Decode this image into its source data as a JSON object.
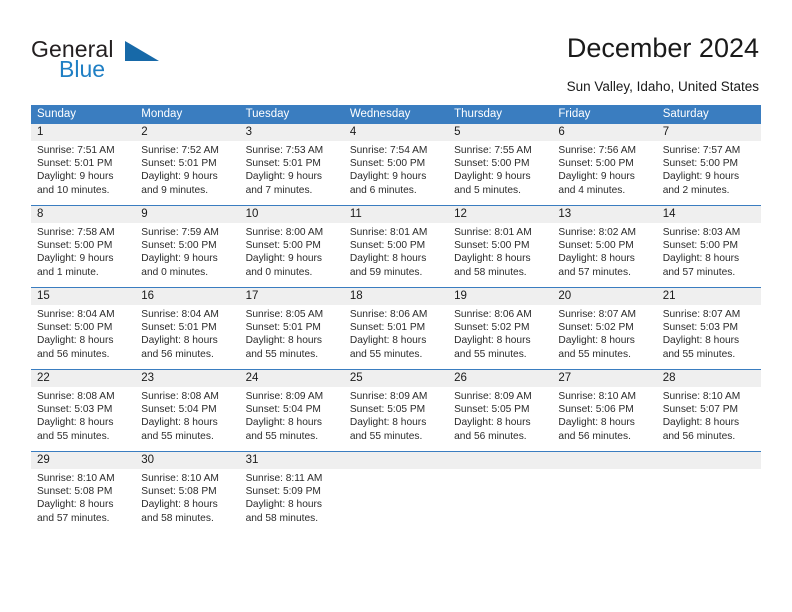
{
  "brand": {
    "name_top": "General",
    "name_bottom": "Blue",
    "accent_color": "#1769a8",
    "text_color": "#231f20"
  },
  "header": {
    "title": "December 2024",
    "subtitle": "Sun Valley, Idaho, United States"
  },
  "theme": {
    "header_row_bg": "#3a7dc0",
    "header_row_text": "#ffffff",
    "daynum_bg": "#efefef",
    "cell_bg": "#ffffff",
    "week_divider": "#3a7dc0"
  },
  "day_headers": [
    "Sunday",
    "Monday",
    "Tuesday",
    "Wednesday",
    "Thursday",
    "Friday",
    "Saturday"
  ],
  "weeks": [
    {
      "days": [
        {
          "num": "1",
          "sunrise": "Sunrise: 7:51 AM",
          "sunset": "Sunset: 5:01 PM",
          "daylight1": "Daylight: 9 hours",
          "daylight2": "and 10 minutes."
        },
        {
          "num": "2",
          "sunrise": "Sunrise: 7:52 AM",
          "sunset": "Sunset: 5:01 PM",
          "daylight1": "Daylight: 9 hours",
          "daylight2": "and 9 minutes."
        },
        {
          "num": "3",
          "sunrise": "Sunrise: 7:53 AM",
          "sunset": "Sunset: 5:01 PM",
          "daylight1": "Daylight: 9 hours",
          "daylight2": "and 7 minutes."
        },
        {
          "num": "4",
          "sunrise": "Sunrise: 7:54 AM",
          "sunset": "Sunset: 5:00 PM",
          "daylight1": "Daylight: 9 hours",
          "daylight2": "and 6 minutes."
        },
        {
          "num": "5",
          "sunrise": "Sunrise: 7:55 AM",
          "sunset": "Sunset: 5:00 PM",
          "daylight1": "Daylight: 9 hours",
          "daylight2": "and 5 minutes."
        },
        {
          "num": "6",
          "sunrise": "Sunrise: 7:56 AM",
          "sunset": "Sunset: 5:00 PM",
          "daylight1": "Daylight: 9 hours",
          "daylight2": "and 4 minutes."
        },
        {
          "num": "7",
          "sunrise": "Sunrise: 7:57 AM",
          "sunset": "Sunset: 5:00 PM",
          "daylight1": "Daylight: 9 hours",
          "daylight2": "and 2 minutes."
        }
      ]
    },
    {
      "days": [
        {
          "num": "8",
          "sunrise": "Sunrise: 7:58 AM",
          "sunset": "Sunset: 5:00 PM",
          "daylight1": "Daylight: 9 hours",
          "daylight2": "and 1 minute."
        },
        {
          "num": "9",
          "sunrise": "Sunrise: 7:59 AM",
          "sunset": "Sunset: 5:00 PM",
          "daylight1": "Daylight: 9 hours",
          "daylight2": "and 0 minutes."
        },
        {
          "num": "10",
          "sunrise": "Sunrise: 8:00 AM",
          "sunset": "Sunset: 5:00 PM",
          "daylight1": "Daylight: 9 hours",
          "daylight2": "and 0 minutes."
        },
        {
          "num": "11",
          "sunrise": "Sunrise: 8:01 AM",
          "sunset": "Sunset: 5:00 PM",
          "daylight1": "Daylight: 8 hours",
          "daylight2": "and 59 minutes."
        },
        {
          "num": "12",
          "sunrise": "Sunrise: 8:01 AM",
          "sunset": "Sunset: 5:00 PM",
          "daylight1": "Daylight: 8 hours",
          "daylight2": "and 58 minutes."
        },
        {
          "num": "13",
          "sunrise": "Sunrise: 8:02 AM",
          "sunset": "Sunset: 5:00 PM",
          "daylight1": "Daylight: 8 hours",
          "daylight2": "and 57 minutes."
        },
        {
          "num": "14",
          "sunrise": "Sunrise: 8:03 AM",
          "sunset": "Sunset: 5:00 PM",
          "daylight1": "Daylight: 8 hours",
          "daylight2": "and 57 minutes."
        }
      ]
    },
    {
      "days": [
        {
          "num": "15",
          "sunrise": "Sunrise: 8:04 AM",
          "sunset": "Sunset: 5:00 PM",
          "daylight1": "Daylight: 8 hours",
          "daylight2": "and 56 minutes."
        },
        {
          "num": "16",
          "sunrise": "Sunrise: 8:04 AM",
          "sunset": "Sunset: 5:01 PM",
          "daylight1": "Daylight: 8 hours",
          "daylight2": "and 56 minutes."
        },
        {
          "num": "17",
          "sunrise": "Sunrise: 8:05 AM",
          "sunset": "Sunset: 5:01 PM",
          "daylight1": "Daylight: 8 hours",
          "daylight2": "and 55 minutes."
        },
        {
          "num": "18",
          "sunrise": "Sunrise: 8:06 AM",
          "sunset": "Sunset: 5:01 PM",
          "daylight1": "Daylight: 8 hours",
          "daylight2": "and 55 minutes."
        },
        {
          "num": "19",
          "sunrise": "Sunrise: 8:06 AM",
          "sunset": "Sunset: 5:02 PM",
          "daylight1": "Daylight: 8 hours",
          "daylight2": "and 55 minutes."
        },
        {
          "num": "20",
          "sunrise": "Sunrise: 8:07 AM",
          "sunset": "Sunset: 5:02 PM",
          "daylight1": "Daylight: 8 hours",
          "daylight2": "and 55 minutes."
        },
        {
          "num": "21",
          "sunrise": "Sunrise: 8:07 AM",
          "sunset": "Sunset: 5:03 PM",
          "daylight1": "Daylight: 8 hours",
          "daylight2": "and 55 minutes."
        }
      ]
    },
    {
      "days": [
        {
          "num": "22",
          "sunrise": "Sunrise: 8:08 AM",
          "sunset": "Sunset: 5:03 PM",
          "daylight1": "Daylight: 8 hours",
          "daylight2": "and 55 minutes."
        },
        {
          "num": "23",
          "sunrise": "Sunrise: 8:08 AM",
          "sunset": "Sunset: 5:04 PM",
          "daylight1": "Daylight: 8 hours",
          "daylight2": "and 55 minutes."
        },
        {
          "num": "24",
          "sunrise": "Sunrise: 8:09 AM",
          "sunset": "Sunset: 5:04 PM",
          "daylight1": "Daylight: 8 hours",
          "daylight2": "and 55 minutes."
        },
        {
          "num": "25",
          "sunrise": "Sunrise: 8:09 AM",
          "sunset": "Sunset: 5:05 PM",
          "daylight1": "Daylight: 8 hours",
          "daylight2": "and 55 minutes."
        },
        {
          "num": "26",
          "sunrise": "Sunrise: 8:09 AM",
          "sunset": "Sunset: 5:05 PM",
          "daylight1": "Daylight: 8 hours",
          "daylight2": "and 56 minutes."
        },
        {
          "num": "27",
          "sunrise": "Sunrise: 8:10 AM",
          "sunset": "Sunset: 5:06 PM",
          "daylight1": "Daylight: 8 hours",
          "daylight2": "and 56 minutes."
        },
        {
          "num": "28",
          "sunrise": "Sunrise: 8:10 AM",
          "sunset": "Sunset: 5:07 PM",
          "daylight1": "Daylight: 8 hours",
          "daylight2": "and 56 minutes."
        }
      ]
    },
    {
      "days": [
        {
          "num": "29",
          "sunrise": "Sunrise: 8:10 AM",
          "sunset": "Sunset: 5:08 PM",
          "daylight1": "Daylight: 8 hours",
          "daylight2": "and 57 minutes."
        },
        {
          "num": "30",
          "sunrise": "Sunrise: 8:10 AM",
          "sunset": "Sunset: 5:08 PM",
          "daylight1": "Daylight: 8 hours",
          "daylight2": "and 58 minutes."
        },
        {
          "num": "31",
          "sunrise": "Sunrise: 8:11 AM",
          "sunset": "Sunset: 5:09 PM",
          "daylight1": "Daylight: 8 hours",
          "daylight2": "and 58 minutes."
        },
        null,
        null,
        null,
        null
      ]
    }
  ]
}
